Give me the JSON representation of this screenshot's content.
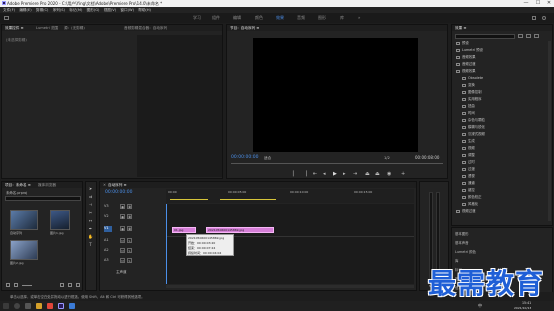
{
  "window": {
    "title": "Adobe Premiere Pro 2020 - C:\\用户\\Ying\\文档\\Adobe\\Premiere Pro\\14.0\\未命名 *",
    "minimize": "—",
    "maximize": "☐",
    "close": "✕"
  },
  "menu": [
    "文件(F)",
    "编辑(E)",
    "剪辑(C)",
    "序列(S)",
    "标记(M)",
    "图形(G)",
    "视图(V)",
    "窗口(W)",
    "帮助(H)"
  ],
  "workspaces": [
    "学习",
    "组件",
    "编辑",
    "颜色",
    "效果",
    "音频",
    "图形",
    "库"
  ],
  "workspace_active": "效果",
  "source_panel": {
    "tabs": [
      "效果控件 ≡",
      "Lumetri 范围",
      "源：(无剪辑)",
      "音频剪辑混合器：自动序列"
    ],
    "empty_text": "(未选择剪辑)"
  },
  "program_monitor": {
    "tab": "节目：自动序列 ≡",
    "timecode_left": "00:00:00:00",
    "fit": "适合",
    "zoom": "1/2",
    "timecode_right": "00:00:08:00"
  },
  "effects_panel": {
    "tab": "效果 ≡",
    "items": [
      "预设",
      "Lumetri 预设",
      "音频效果",
      "音频过渡",
      "视频效果",
      "Obsolete",
      "变换",
      "图像控制",
      "实用程序",
      "扭曲",
      "时间",
      "杂色与颗粒",
      "模糊与锐化",
      "沉浸式视频",
      "生成",
      "视频",
      "调整",
      "过时",
      "过渡",
      "透视",
      "通道",
      "键控",
      "颜色校正",
      "风格化",
      "视频过渡"
    ],
    "lower_tabs": [
      "基本图形",
      "基本声音",
      "Lumetri 颜色",
      "库",
      "标记",
      "历史记录",
      "信息"
    ]
  },
  "project_panel": {
    "tabs": [
      "项目：未命名 ≡",
      "媒体浏览器"
    ],
    "name": "未命名.prproj",
    "items": [
      "自动序列",
      "图片1.jpg",
      "图片2.jpg"
    ]
  },
  "timeline": {
    "tab": "自动序列 ≡",
    "timecode": "00:00:00:00",
    "ruler": [
      "00:00",
      "00:00:05:00",
      "00:00:10:00",
      "00:00:15:00"
    ],
    "tracks": [
      "V3",
      "V2",
      "V1",
      "A1",
      "A2",
      "A3",
      "主声道"
    ],
    "clips": [
      "01.jpg",
      "2021050600145869.jpg"
    ],
    "tooltip": [
      "2021050600145869.jpg",
      "开始：00:00:03:20",
      "结束：00:00:07:24",
      "持续时间：00:00:04:04"
    ]
  },
  "statusbar": "单击以选择，或单击空白处并拖动以进行框选。使用 Shift、Alt 和 Ctrl 可获得其他选项。",
  "taskbar": {
    "time": "15:41",
    "date": "2021/10/13",
    "lang": "中"
  },
  "watermark": "最需教育"
}
